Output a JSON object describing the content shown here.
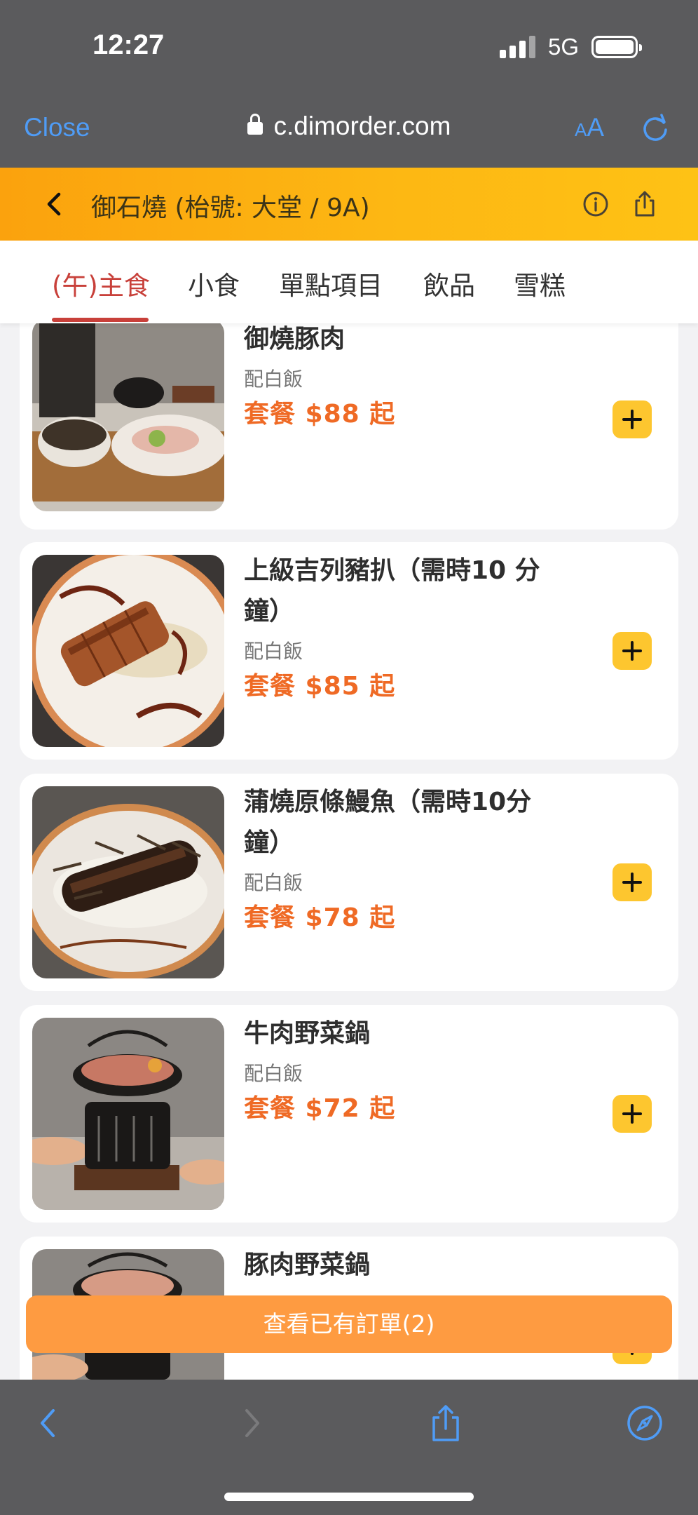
{
  "status_bar": {
    "time": "12:27",
    "network": "5G"
  },
  "browser": {
    "close_label": "Close",
    "url": "c.dimorder.com",
    "text_size_small": "A",
    "text_size_large": "A"
  },
  "store": {
    "title": "御石燒 (枱號: 大堂 / 9A)"
  },
  "tabs": [
    {
      "label": "(午)主食",
      "active": true
    },
    {
      "label": "小食",
      "active": false
    },
    {
      "label": "單點項目",
      "active": false
    },
    {
      "label": "飲品",
      "active": false
    },
    {
      "label": "雪糕",
      "active": false
    }
  ],
  "menu_items": [
    {
      "name": "御燒豚肉",
      "desc": "配白飯",
      "price": "套餐 $88 起"
    },
    {
      "name": "上級吉列豬扒（需時10 分鐘）",
      "desc": "配白飯",
      "price": "套餐 $85 起"
    },
    {
      "name": "蒲燒原條鰻魚（需時10分鐘）",
      "desc": "配白飯",
      "price": "套餐 $78 起"
    },
    {
      "name": "牛肉野菜鍋",
      "desc": "配白飯",
      "price": "套餐 $72 起"
    },
    {
      "name": "豚肉野菜鍋",
      "desc": "",
      "price": ""
    }
  ],
  "order_bar": {
    "label": "查看已有訂單(2)"
  },
  "colors": {
    "accent_orange": "#fdb713",
    "tab_active": "#c8403a",
    "price": "#ef6a25",
    "add_button": "#fdc62f",
    "order_bar": "#fe9b41",
    "link_blue": "#4f9cf6"
  },
  "icons": {
    "back": "chevron-left-icon",
    "info": "info-icon",
    "share": "share-icon",
    "lock": "lock-icon",
    "reload": "reload-icon",
    "compass": "compass-icon",
    "forward": "chevron-right-icon",
    "add": "plus-icon"
  }
}
